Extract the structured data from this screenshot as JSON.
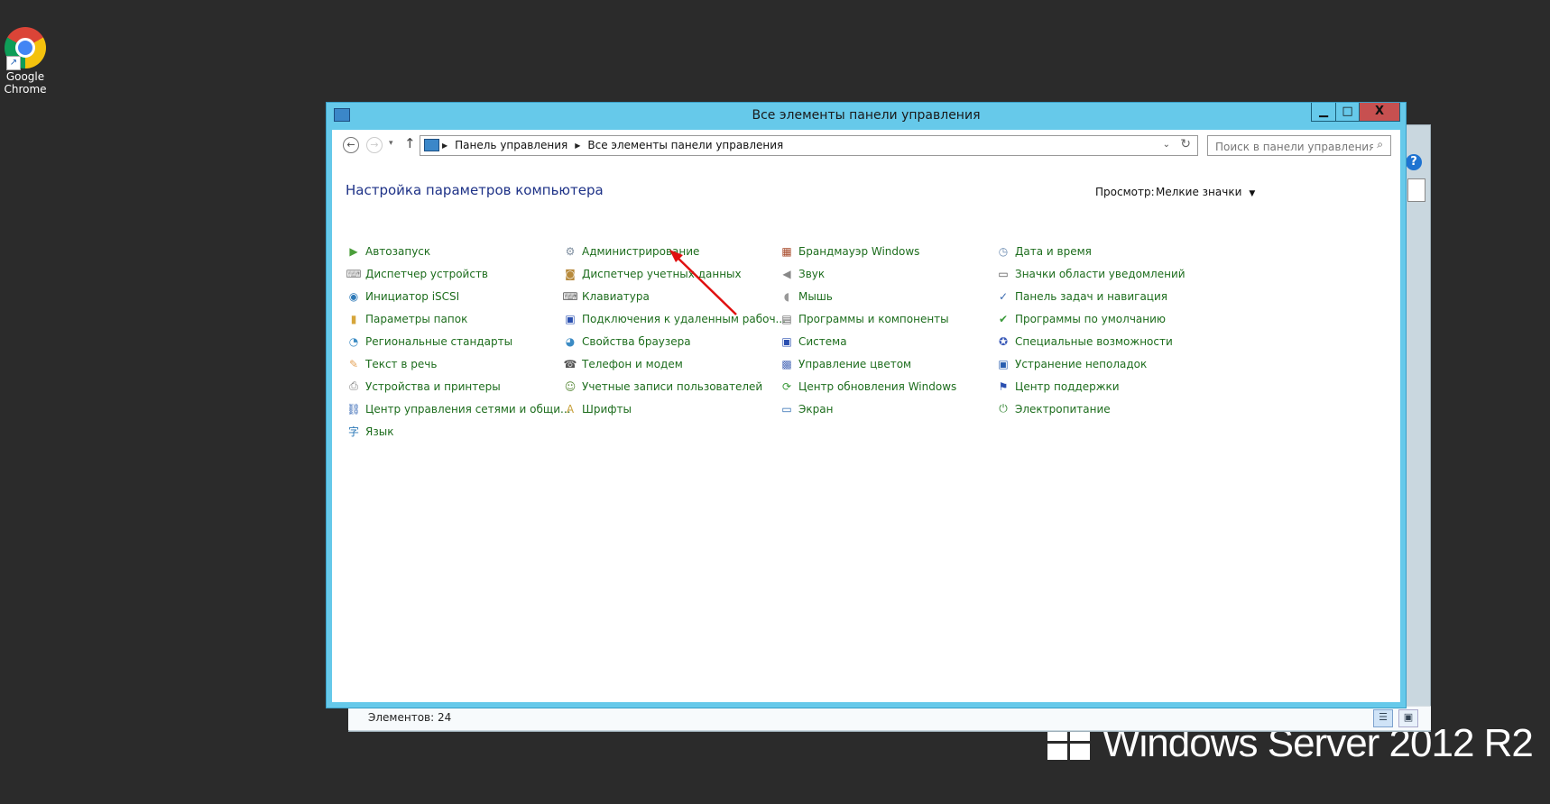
{
  "desktop": {
    "shortcut_label_line1": "Google",
    "shortcut_label_line2": "Chrome",
    "os_branding": "Windows Server 2012 R2"
  },
  "window": {
    "title": "Все элементы панели управления",
    "controls": {
      "minimize": "▁",
      "maximize": "□",
      "close": "X"
    }
  },
  "nav": {
    "back": "←",
    "forward": "→",
    "recent": "▾",
    "up": "↑",
    "breadcrumb": [
      "Панель управления",
      "Все элементы панели управления"
    ],
    "refresh": "↻",
    "dropdown": "⌄",
    "search_placeholder": "Поиск в панели управления",
    "search_icon": "⌕"
  },
  "content": {
    "heading": "Настройка параметров компьютера",
    "view_label": "Просмотр:",
    "view_value": "Мелкие значки",
    "columns": [
      [
        {
          "label": "Автозапуск",
          "icon": "autoplay-icon",
          "glyph": "▶",
          "color": "#4a9e3a"
        },
        {
          "label": "Диспетчер устройств",
          "icon": "device-manager-icon",
          "glyph": "⌨",
          "color": "#8a8a8a"
        },
        {
          "label": "Инициатор iSCSI",
          "icon": "iscsi-globe-icon",
          "glyph": "◉",
          "color": "#2e7ab8"
        },
        {
          "label": "Параметры папок",
          "icon": "folder-options-icon",
          "glyph": "▮",
          "color": "#d6a53a"
        },
        {
          "label": "Региональные стандарты",
          "icon": "region-globe-icon",
          "glyph": "◔",
          "color": "#3b8bc4"
        },
        {
          "label": "Текст в речь",
          "icon": "speech-bubble-icon",
          "glyph": "✎",
          "color": "#e5a45a"
        },
        {
          "label": "Устройства и принтеры",
          "icon": "printer-icon",
          "glyph": "⎙",
          "color": "#777777"
        },
        {
          "label": "Центр управления сетями и общи...",
          "icon": "network-center-icon",
          "glyph": "⛓",
          "color": "#2a5fb0"
        },
        {
          "label": "Язык",
          "icon": "language-icon",
          "glyph": "字",
          "color": "#2e7ab8"
        }
      ],
      [
        {
          "label": "Администрирование",
          "icon": "admin-tools-icon",
          "glyph": "⚙",
          "color": "#7f8fa0"
        },
        {
          "label": "Диспетчер учетных данных",
          "icon": "credential-vault-icon",
          "glyph": "◙",
          "color": "#b78a3c"
        },
        {
          "label": "Клавиатура",
          "icon": "keyboard-icon",
          "glyph": "⌨",
          "color": "#666666"
        },
        {
          "label": "Подключения к удаленным рабоч...",
          "icon": "remote-desktop-icon",
          "glyph": "▣",
          "color": "#2a4fb0"
        },
        {
          "label": "Свойства браузера",
          "icon": "internet-options-icon",
          "glyph": "◕",
          "color": "#3b8bc4"
        },
        {
          "label": "Телефон и модем",
          "icon": "phone-modem-icon",
          "glyph": "☎",
          "color": "#555555"
        },
        {
          "label": "Учетные записи пользователей",
          "icon": "user-accounts-icon",
          "glyph": "☺",
          "color": "#5a8a3a"
        },
        {
          "label": "Шрифты",
          "icon": "fonts-icon",
          "glyph": "A",
          "color": "#c7a03a"
        }
      ],
      [
        {
          "label": "Брандмауэр Windows",
          "icon": "firewall-icon",
          "glyph": "▦",
          "color": "#a84a2a"
        },
        {
          "label": "Звук",
          "icon": "speaker-icon",
          "glyph": "◀",
          "color": "#888888"
        },
        {
          "label": "Мышь",
          "icon": "mouse-icon",
          "glyph": "◖",
          "color": "#999999"
        },
        {
          "label": "Программы и компоненты",
          "icon": "programs-features-icon",
          "glyph": "▤",
          "color": "#6a6a6a"
        },
        {
          "label": "Система",
          "icon": "system-icon",
          "glyph": "▣",
          "color": "#2a4fb0"
        },
        {
          "label": "Управление цветом",
          "icon": "color-management-icon",
          "glyph": "▩",
          "color": "#4a6ab8"
        },
        {
          "label": "Центр обновления Windows",
          "icon": "windows-update-icon",
          "glyph": "⟳",
          "color": "#3a9a3a"
        },
        {
          "label": "Экран",
          "icon": "display-icon",
          "glyph": "▭",
          "color": "#2a6ab0"
        }
      ],
      [
        {
          "label": "Дата и время",
          "icon": "date-time-icon",
          "glyph": "◷",
          "color": "#6a8ab0"
        },
        {
          "label": "Значки области уведомлений",
          "icon": "notification-icons-icon",
          "glyph": "▭",
          "color": "#555555"
        },
        {
          "label": "Панель задач и навигация",
          "icon": "taskbar-icon",
          "glyph": "✓",
          "color": "#3a6ab0"
        },
        {
          "label": "Программы по умолчанию",
          "icon": "default-programs-icon",
          "glyph": "✔",
          "color": "#3a9a3a"
        },
        {
          "label": "Специальные возможности",
          "icon": "ease-of-access-icon",
          "glyph": "✪",
          "color": "#3a5ab8"
        },
        {
          "label": "Устранение неполадок",
          "icon": "troubleshooting-icon",
          "glyph": "▣",
          "color": "#2a5fb0"
        },
        {
          "label": "Центр поддержки",
          "icon": "action-center-flag-icon",
          "glyph": "⚑",
          "color": "#2a4fb0"
        },
        {
          "label": "Электропитание",
          "icon": "power-options-icon",
          "glyph": "⏻",
          "color": "#3a8a3a"
        }
      ]
    ]
  },
  "status_bar": {
    "item_count": "Элементов: 24"
  },
  "annotation": {
    "arrow_color": "#e01010",
    "points_to": "Администрирование"
  }
}
